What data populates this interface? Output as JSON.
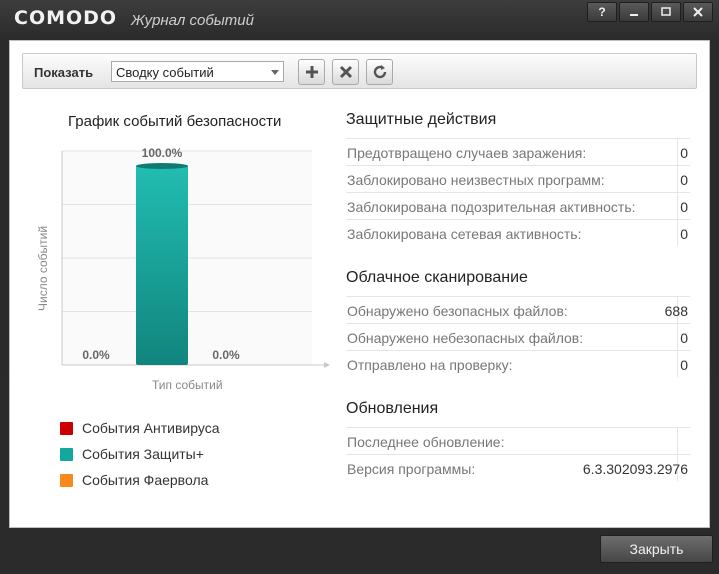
{
  "window": {
    "brand": "COMODO",
    "title": "Журнал событий",
    "controls": [
      "?",
      "minimize",
      "maximize",
      "close"
    ]
  },
  "toolbar": {
    "show_label": "Показать",
    "select_value": "Сводку событий",
    "buttons": [
      "add-icon",
      "delete-icon",
      "refresh-icon"
    ]
  },
  "chart_data": {
    "type": "bar",
    "title": "График событий безопасности",
    "xlabel": "Тип событий",
    "ylabel": "Число событий",
    "categories": [
      "События Антивируса",
      "События Защиты+",
      "События Фаервола"
    ],
    "values": [
      0.0,
      100.0,
      0.0
    ],
    "value_labels": [
      "0.0%",
      "100.0%",
      "0.0%"
    ],
    "colors": [
      "#cc0000",
      "#1aa39a",
      "#f08a1c"
    ],
    "ylim": [
      0,
      100
    ],
    "grid": true
  },
  "legend": [
    {
      "label": "События Антивируса",
      "color": "#cc0000"
    },
    {
      "label": "События Защиты+",
      "color": "#13a89e"
    },
    {
      "label": "События Фаервола",
      "color": "#f7891f"
    }
  ],
  "protective_actions": {
    "title": "Защитные действия",
    "rows": [
      {
        "label": "Предотвращено случаев заражения:",
        "value": "0"
      },
      {
        "label": "Заблокировано неизвестных программ:",
        "value": "0"
      },
      {
        "label": "Заблокирована подозрительная активность:",
        "value": "0"
      },
      {
        "label": "Заблокирована сетевая активность:",
        "value": "0"
      }
    ]
  },
  "cloud_scan": {
    "title": "Облачное сканирование",
    "rows": [
      {
        "label": "Обнаружено безопасных файлов:",
        "value": "688"
      },
      {
        "label": "Обнаружено небезопасных файлов:",
        "value": "0"
      },
      {
        "label": "Отправлено на проверку:",
        "value": "0"
      }
    ]
  },
  "updates": {
    "title": "Обновления",
    "rows": [
      {
        "label": "Последнее обновление:",
        "value": ""
      },
      {
        "label": "Версия программы:",
        "value": "6.3.302093.2976"
      }
    ]
  },
  "footer": {
    "close_label": "Закрыть"
  }
}
